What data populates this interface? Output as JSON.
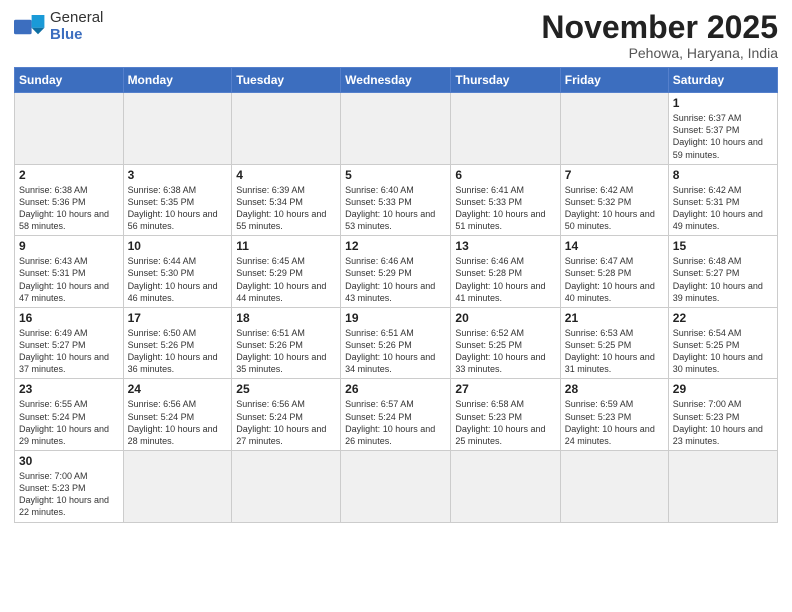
{
  "logo": {
    "text_general": "General",
    "text_blue": "Blue"
  },
  "header": {
    "month_year": "November 2025",
    "location": "Pehowa, Haryana, India"
  },
  "weekdays": [
    "Sunday",
    "Monday",
    "Tuesday",
    "Wednesday",
    "Thursday",
    "Friday",
    "Saturday"
  ],
  "weeks": [
    [
      {
        "day": "",
        "empty": true
      },
      {
        "day": "",
        "empty": true
      },
      {
        "day": "",
        "empty": true
      },
      {
        "day": "",
        "empty": true
      },
      {
        "day": "",
        "empty": true
      },
      {
        "day": "",
        "empty": true
      },
      {
        "day": "1",
        "sunrise": "6:37 AM",
        "sunset": "5:37 PM",
        "daylight": "10 hours and 59 minutes."
      }
    ],
    [
      {
        "day": "2",
        "sunrise": "6:38 AM",
        "sunset": "5:36 PM",
        "daylight": "10 hours and 58 minutes."
      },
      {
        "day": "3",
        "sunrise": "6:38 AM",
        "sunset": "5:35 PM",
        "daylight": "10 hours and 56 minutes."
      },
      {
        "day": "4",
        "sunrise": "6:39 AM",
        "sunset": "5:34 PM",
        "daylight": "10 hours and 55 minutes."
      },
      {
        "day": "5",
        "sunrise": "6:40 AM",
        "sunset": "5:33 PM",
        "daylight": "10 hours and 53 minutes."
      },
      {
        "day": "6",
        "sunrise": "6:41 AM",
        "sunset": "5:33 PM",
        "daylight": "10 hours and 51 minutes."
      },
      {
        "day": "7",
        "sunrise": "6:42 AM",
        "sunset": "5:32 PM",
        "daylight": "10 hours and 50 minutes."
      },
      {
        "day": "8",
        "sunrise": "6:42 AM",
        "sunset": "5:31 PM",
        "daylight": "10 hours and 49 minutes."
      }
    ],
    [
      {
        "day": "9",
        "sunrise": "6:43 AM",
        "sunset": "5:31 PM",
        "daylight": "10 hours and 47 minutes."
      },
      {
        "day": "10",
        "sunrise": "6:44 AM",
        "sunset": "5:30 PM",
        "daylight": "10 hours and 46 minutes."
      },
      {
        "day": "11",
        "sunrise": "6:45 AM",
        "sunset": "5:29 PM",
        "daylight": "10 hours and 44 minutes."
      },
      {
        "day": "12",
        "sunrise": "6:46 AM",
        "sunset": "5:29 PM",
        "daylight": "10 hours and 43 minutes."
      },
      {
        "day": "13",
        "sunrise": "6:46 AM",
        "sunset": "5:28 PM",
        "daylight": "10 hours and 41 minutes."
      },
      {
        "day": "14",
        "sunrise": "6:47 AM",
        "sunset": "5:28 PM",
        "daylight": "10 hours and 40 minutes."
      },
      {
        "day": "15",
        "sunrise": "6:48 AM",
        "sunset": "5:27 PM",
        "daylight": "10 hours and 39 minutes."
      }
    ],
    [
      {
        "day": "16",
        "sunrise": "6:49 AM",
        "sunset": "5:27 PM",
        "daylight": "10 hours and 37 minutes."
      },
      {
        "day": "17",
        "sunrise": "6:50 AM",
        "sunset": "5:26 PM",
        "daylight": "10 hours and 36 minutes."
      },
      {
        "day": "18",
        "sunrise": "6:51 AM",
        "sunset": "5:26 PM",
        "daylight": "10 hours and 35 minutes."
      },
      {
        "day": "19",
        "sunrise": "6:51 AM",
        "sunset": "5:26 PM",
        "daylight": "10 hours and 34 minutes."
      },
      {
        "day": "20",
        "sunrise": "6:52 AM",
        "sunset": "5:25 PM",
        "daylight": "10 hours and 33 minutes."
      },
      {
        "day": "21",
        "sunrise": "6:53 AM",
        "sunset": "5:25 PM",
        "daylight": "10 hours and 31 minutes."
      },
      {
        "day": "22",
        "sunrise": "6:54 AM",
        "sunset": "5:25 PM",
        "daylight": "10 hours and 30 minutes."
      }
    ],
    [
      {
        "day": "23",
        "sunrise": "6:55 AM",
        "sunset": "5:24 PM",
        "daylight": "10 hours and 29 minutes."
      },
      {
        "day": "24",
        "sunrise": "6:56 AM",
        "sunset": "5:24 PM",
        "daylight": "10 hours and 28 minutes."
      },
      {
        "day": "25",
        "sunrise": "6:56 AM",
        "sunset": "5:24 PM",
        "daylight": "10 hours and 27 minutes."
      },
      {
        "day": "26",
        "sunrise": "6:57 AM",
        "sunset": "5:24 PM",
        "daylight": "10 hours and 26 minutes."
      },
      {
        "day": "27",
        "sunrise": "6:58 AM",
        "sunset": "5:23 PM",
        "daylight": "10 hours and 25 minutes."
      },
      {
        "day": "28",
        "sunrise": "6:59 AM",
        "sunset": "5:23 PM",
        "daylight": "10 hours and 24 minutes."
      },
      {
        "day": "29",
        "sunrise": "7:00 AM",
        "sunset": "5:23 PM",
        "daylight": "10 hours and 23 minutes."
      }
    ],
    [
      {
        "day": "30",
        "sunrise": "7:00 AM",
        "sunset": "5:23 PM",
        "daylight": "10 hours and 22 minutes."
      },
      {
        "day": "",
        "empty": true
      },
      {
        "day": "",
        "empty": true
      },
      {
        "day": "",
        "empty": true
      },
      {
        "day": "",
        "empty": true
      },
      {
        "day": "",
        "empty": true
      },
      {
        "day": "",
        "empty": true
      }
    ]
  ]
}
